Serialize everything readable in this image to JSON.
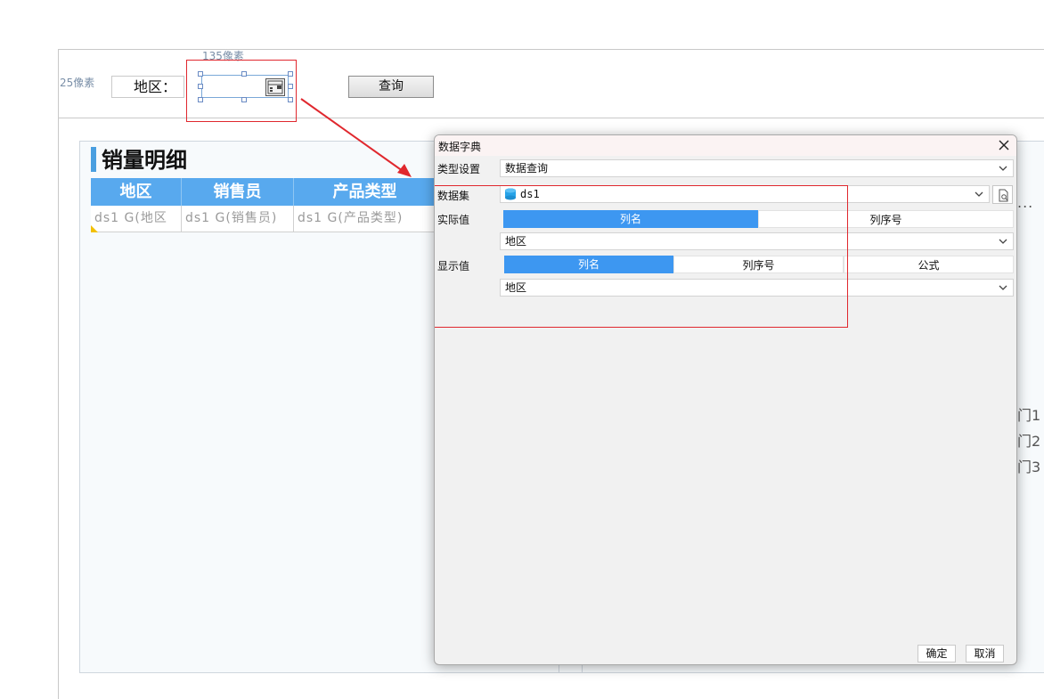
{
  "designer": {
    "height_px_label": "135像素",
    "width_px_label": "25像素",
    "region_label": "地区：",
    "query_label": "查询"
  },
  "report": {
    "title": "销量明细",
    "columns": [
      "地区",
      "销售员",
      "产品类型"
    ],
    "cells": [
      "ds1 G(地区",
      "ds1 G(销售员)",
      "ds1 G(产品类型)"
    ],
    "row_labels": [
      "门1",
      "门2",
      "门3"
    ],
    "ellipsis": "..."
  },
  "dialog": {
    "title": "数据字典",
    "type_label": "类型设置",
    "type_value": "数据查询",
    "dataset_label": "数据集",
    "dataset_value": "ds1",
    "actual_label": "实际值",
    "actual_tabs": [
      "列名",
      "列序号"
    ],
    "actual_value": "地区",
    "display_label": "显示值",
    "display_tabs": [
      "列名",
      "列序号",
      "公式"
    ],
    "display_value": "地区",
    "ok_label": "确定",
    "cancel_label": "取消"
  },
  "colors": {
    "accent_blue": "#3d97f1",
    "header_blue": "#58a9ee",
    "highlight_red": "#e0282e"
  }
}
